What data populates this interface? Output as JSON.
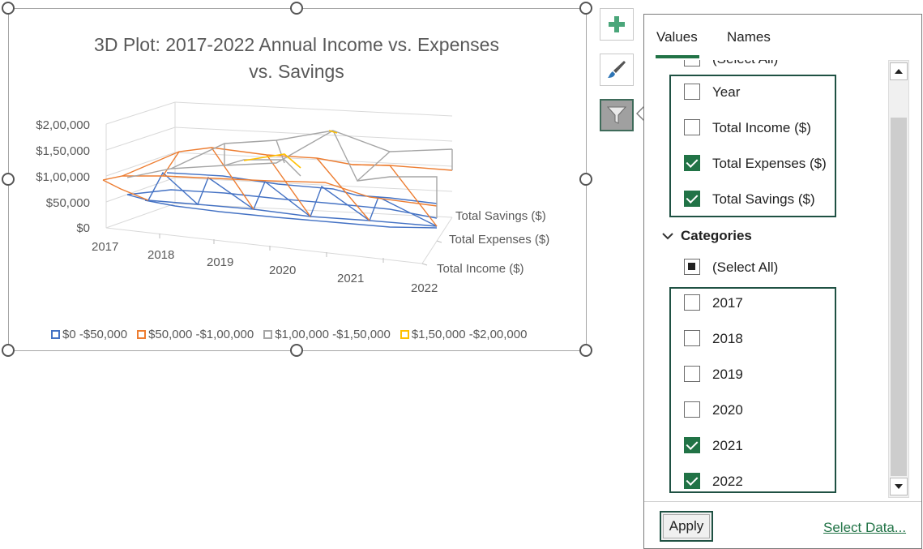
{
  "chart": {
    "title_line1": "3D Plot: 2017-2022 Annual Income vs. Expenses",
    "title_line2": "vs. Savings",
    "y_ticks": [
      "$2,00,000",
      "$1,50,000",
      "$1,00,000",
      "$50,000",
      "$0"
    ],
    "x_ticks": [
      "2017",
      "2018",
      "2019",
      "2020",
      "2021",
      "2022"
    ],
    "depth_ticks": [
      "Total Savings ($)",
      "Total Expenses ($)",
      "Total Income ($)"
    ],
    "legend": [
      {
        "label": "$0 -$50,000",
        "color": "#4472c4"
      },
      {
        "label": "$50,000 -$1,00,000",
        "color": "#ed7d31"
      },
      {
        "label": "$1,00,000 -$1,50,000",
        "color": "#a5a5a5"
      },
      {
        "label": "$1,50,000 -$2,00,000",
        "color": "#ffc000"
      }
    ]
  },
  "chart_data": {
    "type": "surface-wireframe",
    "title": "3D Plot: 2017-2022 Annual Income vs. Expenses vs. Savings",
    "categories": [
      "2017",
      "2018",
      "2019",
      "2020",
      "2021",
      "2022"
    ],
    "series_axis": [
      "Total Income ($)",
      "Total Expenses ($)",
      "Total Savings ($)"
    ],
    "ylim": [
      0,
      200000
    ],
    "legend_bands": [
      "$0 -$50,000",
      "$50,000 -$1,00,000",
      "$1,00,000 -$1,50,000",
      "$1,50,000 -$2,00,000"
    ],
    "legend_position": "bottom"
  },
  "side_buttons": {
    "add": "plus-icon",
    "style": "brush-icon",
    "filter": "funnel-icon"
  },
  "filter_pane": {
    "tabs": [
      "Values",
      "Names"
    ],
    "series_select_all": "(Select All)",
    "series": [
      {
        "label": "Year",
        "checked": false
      },
      {
        "label": "Total Income ($)",
        "checked": false
      },
      {
        "label": "Total Expenses ($)",
        "checked": true
      },
      {
        "label": "Total Savings ($)",
        "checked": true
      }
    ],
    "categories_header": "Categories",
    "categories_select_all": "(Select All)",
    "categories": [
      {
        "label": "2017",
        "checked": false
      },
      {
        "label": "2018",
        "checked": false
      },
      {
        "label": "2019",
        "checked": false
      },
      {
        "label": "2020",
        "checked": false
      },
      {
        "label": "2021",
        "checked": true
      },
      {
        "label": "2022",
        "checked": true
      }
    ],
    "apply_label": "Apply",
    "select_data_label": "Select Data..."
  }
}
